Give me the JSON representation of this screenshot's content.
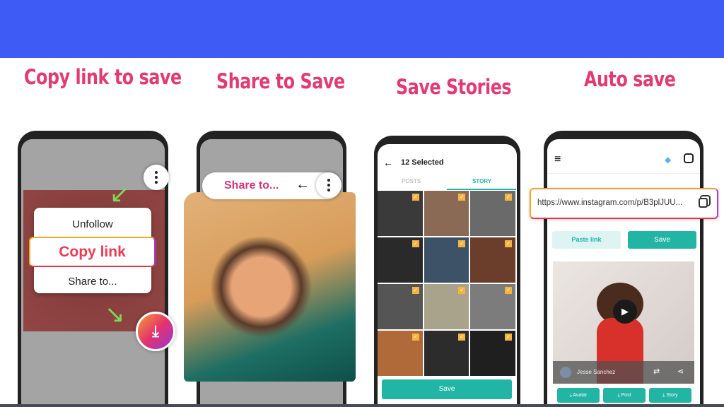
{
  "banner_color": "#3f5bf6",
  "titles": [
    "Copy link to save",
    "Share to Save",
    "Save Stories",
    "Auto save"
  ],
  "panel1": {
    "menu": [
      "Unfollow",
      "Copy link",
      "Share to..."
    ],
    "icons": [
      "more-vert-icon",
      "download-icon",
      "arrow-icon"
    ]
  },
  "panel2": {
    "share_label": "Share to...",
    "icons": [
      "arrow-left-icon",
      "more-vert-icon"
    ]
  },
  "panel3": {
    "header": "12 Selected",
    "tabs": [
      "POSTS",
      "STORY"
    ],
    "active_tab": "STORY",
    "selected_count": 12,
    "save": "Save"
  },
  "panel4": {
    "url": "https://www.instagram.com/p/B3plJUU...",
    "paste": "Paste link",
    "save": "Save",
    "user": "Jesse Sanchez",
    "buttons": [
      "Avatar",
      "Post",
      "Story"
    ]
  },
  "accent": "#22b5a6",
  "title_color": "#e23a72"
}
